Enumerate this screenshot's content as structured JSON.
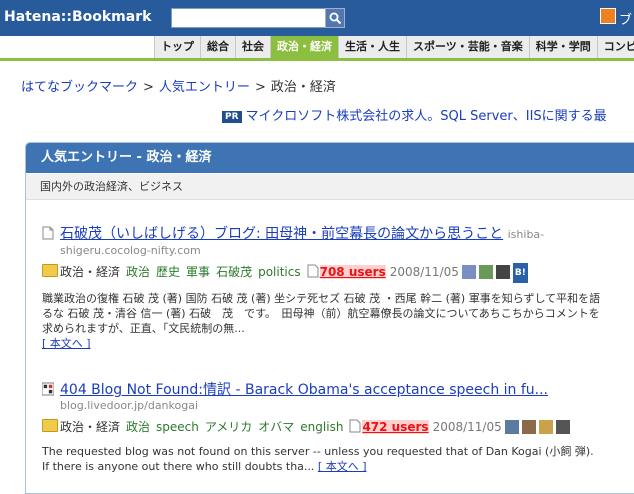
{
  "header": {
    "logo": "Hatena::Bookmark",
    "search_placeholder": "",
    "search_value": "",
    "user_label": "ブ"
  },
  "nav": {
    "tabs": [
      "トップ",
      "総合",
      "社会",
      "政治・経済",
      "生活・人生",
      "スポーツ・芸能・音楽",
      "科学・学問",
      "コンピュ"
    ],
    "active_index": 3
  },
  "breadcrumb": {
    "items": [
      "はてなブックマーク",
      "人気エントリー",
      "政治・経済"
    ],
    "separator": ">"
  },
  "ad": {
    "badge": "PR",
    "text": "マイクロソフト株式会社の求人。SQL Server、IISに関する最"
  },
  "section": {
    "title": "人気エントリー - 政治・経済",
    "description": "国内外の政治経済、ビジネス"
  },
  "entries": [
    {
      "title": "石破茂（いしばしげる）ブログ: 田母神・前空幕長の論文から思うこと",
      "domain_line1": "ishiba-",
      "domain_line2": "shigeru.cocolog-nifty.com",
      "category": "政治・経済",
      "tags": [
        "政治",
        "歴史",
        "軍事",
        "石破茂",
        "politics"
      ],
      "users": "708 users",
      "date": "2008/11/05",
      "summary": "職業政治の復権 石破 茂 (著) 国防 石破 茂 (著) 坐シテ死セズ 石破 茂 ・西尾 幹二 (著) 軍事を知らずして平和を語るな 石破 茂・清谷 信一 (著) 石破　茂　です。　田母神（前）航空幕僚長の論文についてあちこちからコメントを求められますが、正直、「文民統制の無...",
      "more": "[ 本文へ ]"
    },
    {
      "title": "404 Blog Not Found:情訳 - Barack Obama's acceptance speech in fu...",
      "domain_line1": "blog.livedoor.jp/dankogai",
      "domain_line2": "",
      "category": "政治・経済",
      "tags": [
        "政治",
        "speech",
        "アメリカ",
        "オバマ",
        "english"
      ],
      "users": "472 users",
      "date": "2008/11/05",
      "summary": "The requested blog was not found on this server -- unless you requested that of Dan Kogai (小飼 弾). If there is anyone out there who still doubts tha...",
      "more": "[ 本文へ ]"
    }
  ],
  "colors": {
    "header_bg": "#285b9c",
    "tab_active": "#8cbf3f",
    "panel_title_bg": "#3e74b3",
    "users_red": "#e11111",
    "link_blue": "#1a3dbf",
    "tag_green": "#2c7a2c"
  },
  "icons": [
    "search-icon",
    "user-icon",
    "page-icon",
    "folder-icon",
    "favicon-icon",
    "b-badge-icon"
  ]
}
